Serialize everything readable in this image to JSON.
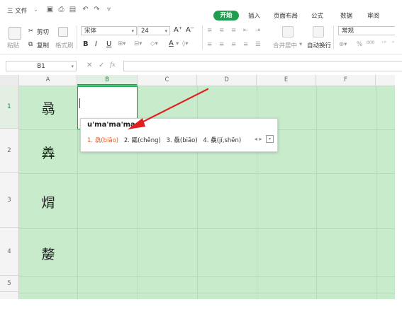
{
  "menubar": {
    "file_menu": "三 文件",
    "tabs": [
      {
        "label": "开始",
        "active": true
      },
      {
        "label": "插入",
        "active": false
      },
      {
        "label": "页面布局",
        "active": false
      },
      {
        "label": "公式",
        "active": false
      },
      {
        "label": "数据",
        "active": false
      },
      {
        "label": "审阅",
        "active": false
      }
    ]
  },
  "ribbon": {
    "paste_label": "粘贴",
    "cut_label": "剪切",
    "copy_label": "复制",
    "format_painter_label": "格式刷",
    "font_name": "宋体",
    "font_size": "24",
    "bold": "B",
    "italic": "I",
    "underline": "U",
    "merge_label": "合并居中",
    "wrap_label": "自动换行",
    "number_format": "常规",
    "percent": "%",
    "thousands": "000"
  },
  "formula_bar": {
    "name_box": "B1",
    "cancel_glyph": "✕",
    "confirm_glyph": "✓",
    "fx_label": "fx",
    "content": ""
  },
  "columns": [
    "A",
    "B",
    "C",
    "D",
    "E",
    "F"
  ],
  "rows": [
    {
      "num": "1",
      "cell_a": "骉"
    },
    {
      "num": "2",
      "cell_a": "羴"
    },
    {
      "num": "3",
      "cell_a": "焨"
    },
    {
      "num": "4",
      "cell_a": "嫠"
    },
    {
      "num": "5",
      "cell_a": ""
    }
  ],
  "ime": {
    "composition": "u'ma'ma'ma",
    "candidates": [
      "1. 骉(biāo)",
      "2. 㼔(chěng)",
      "3. 驫(biāo)",
      "4. 䯂(jí,shēn)"
    ],
    "nav_prev": "◂",
    "nav_next": "▸",
    "more_glyph": "▾"
  },
  "colors": {
    "accent": "#1f9e4e",
    "grid_fill": "#c7ebcb",
    "annotation": "#e02020",
    "candidate_highlight": "#e05a2b"
  }
}
